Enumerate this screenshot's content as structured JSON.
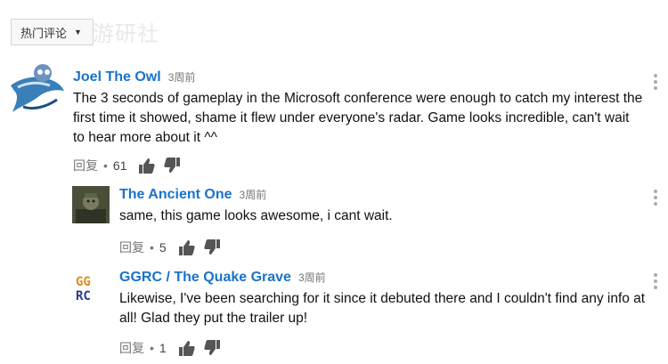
{
  "sort": {
    "label": "热门评论"
  },
  "watermark": "游研社",
  "comments": [
    {
      "author": "Joel The Owl",
      "time": "3周前",
      "text": "The 3 seconds of gameplay in the Microsoft conference were enough to catch my interest the first time it showed, shame it flew under everyone's radar. Game looks incredible, can't wait to hear more about it ^^",
      "reply": "回复",
      "likes": "61"
    },
    {
      "author": "The Ancient One",
      "time": "3周前",
      "text": "same, this game looks awesome, i cant wait.",
      "reply": "回复",
      "likes": "5"
    },
    {
      "author": "GGRC / The Quake Grave",
      "time": "3周前",
      "text": "Likewise, I've been searching for it since it debuted there and I couldn't find any info at all! Glad they put the trailer up!",
      "reply": "回复",
      "likes": "1",
      "avatar_text": "GGRC"
    }
  ],
  "colors": {
    "author": "#1a73c9",
    "meta": "#777777",
    "avatar_orange": "#e08a1e",
    "avatar_blue": "#2a3b8f"
  }
}
